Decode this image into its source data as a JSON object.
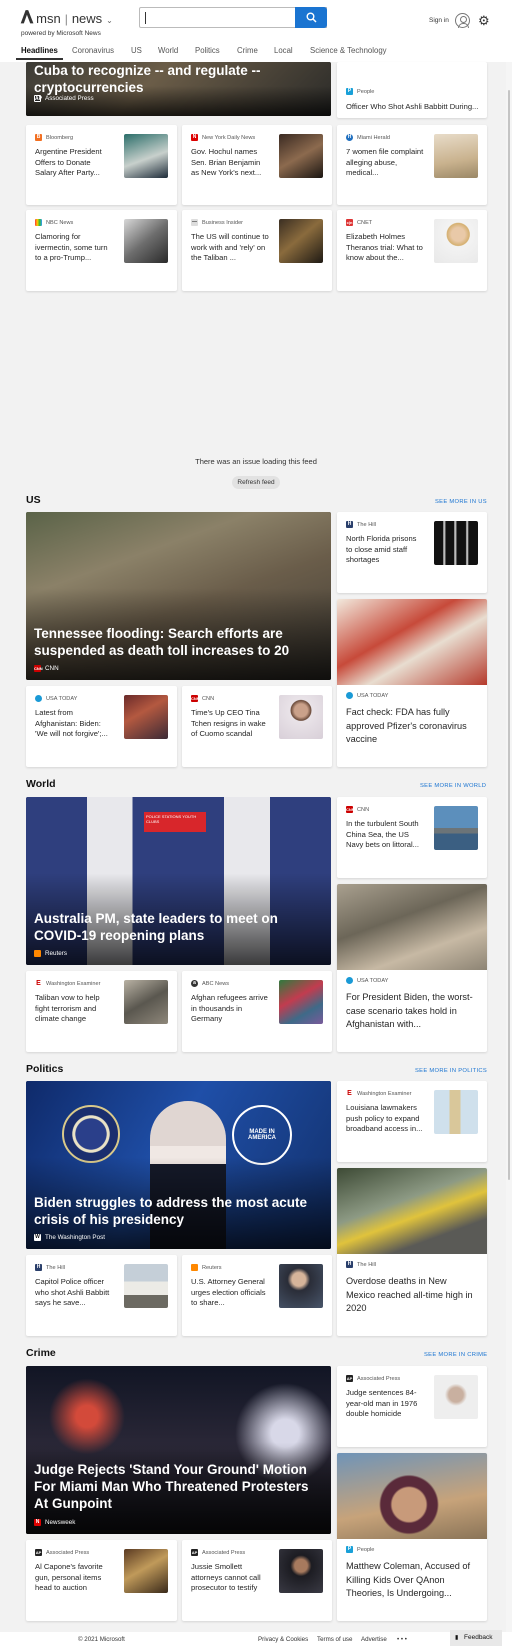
{
  "header": {
    "brand": "msn",
    "section": "news",
    "powered": "powered by Microsoft News",
    "search_value": "",
    "signin": "Sign in",
    "nav": [
      "Headlines",
      "Coronavirus",
      "US",
      "World",
      "Politics",
      "Crime",
      "Local",
      "Science & Technology"
    ]
  },
  "top": {
    "hero_title": "Cuba to recognize -- and regulate -- cryptocurrencies",
    "hero_src": "Associated Press",
    "people_src": "People",
    "people_text": "Officer Who Shot Ashli Babbitt During...",
    "cards": [
      {
        "src": "Bloomberg",
        "text": "Argentine President Offers to Donate Salary After Party..."
      },
      {
        "src": "New York Daily News",
        "text": "Gov. Hochul names Sen. Brian Benjamin as New York's next..."
      },
      {
        "src": "Miami Herald",
        "text": "7 women file complaint alleging abuse, medical..."
      },
      {
        "src": "NBC News",
        "text": "Clamoring for ivermectin, some turn to a pro-Trump..."
      },
      {
        "src": "Business Insider",
        "text": "The US will continue to work with and 'rely' on the Taliban ..."
      },
      {
        "src": "CNET",
        "text": "Elizabeth Holmes Theranos trial: What to know about the..."
      }
    ]
  },
  "feed": {
    "error": "There was an issue loading this feed",
    "refresh": "Refresh feed"
  },
  "us": {
    "title": "US",
    "more": "SEE MORE IN US",
    "hero_title": "Tennessee flooding: Search efforts are suspended as death toll increases to 20",
    "hero_src": "CNN",
    "side": {
      "src": "The Hill",
      "text": "North Florida prisons to close amid staff shortages"
    },
    "tall": {
      "src": "USA TODAY",
      "text": "Fact check: FDA has fully approved Pfizer's coronavirus vaccine"
    },
    "cards": [
      {
        "src": "USA TODAY",
        "text": "Latest from Afghanistan: Biden: 'We will not forgive';..."
      },
      {
        "src": "CNN",
        "text": "Time's Up CEO Tina Tchen resigns in wake of Cuomo scandal"
      }
    ]
  },
  "world": {
    "title": "World",
    "more": "SEE MORE IN WORLD",
    "hero_title": "Australia PM, state leaders to meet on COVID-19 reopening plans",
    "hero_src": "Reuters",
    "side": {
      "src": "CNN",
      "text": "In the turbulent South China Sea, the US Navy bets on littoral..."
    },
    "tall": {
      "src": "USA TODAY",
      "text": "For President Biden, the worst-case scenario takes hold in Afghanistan with..."
    },
    "cards": [
      {
        "src": "Washington Examiner",
        "text": "Taliban vow to help fight terrorism and climate change"
      },
      {
        "src": "ABC News",
        "text": "Afghan refugees arrive in thousands in Germany"
      }
    ],
    "sign": "POLICE STATIONS YOUTH CLUBS"
  },
  "politics": {
    "title": "Politics",
    "more": "SEE MORE IN POLITICS",
    "hero_title": "Biden struggles to address the most acute crisis of his presidency",
    "hero_src": "The Washington Post",
    "badge": "MADE IN AMERICA",
    "side": {
      "src": "Washington Examiner",
      "text": "Louisiana lawmakers push policy to expand broadband access in..."
    },
    "tall": {
      "src": "The Hill",
      "text": "Overdose deaths in New Mexico reached all-time high in 2020"
    },
    "cards": [
      {
        "src": "The Hill",
        "text": "Capitol Police officer who shot Ashli Babbitt says he save..."
      },
      {
        "src": "Reuters",
        "text": "U.S. Attorney General urges election officials to share..."
      }
    ]
  },
  "crime": {
    "title": "Crime",
    "more": "SEE MORE IN CRIME",
    "hero_title": "Judge Rejects 'Stand Your Ground' Motion For Miami Man Who Threatened Protesters At Gunpoint",
    "hero_src": "Newsweek",
    "side": {
      "src": "Associated Press",
      "text": "Judge sentences 84-year-old man in 1976 double homicide"
    },
    "tall": {
      "src": "People",
      "text": "Matthew Coleman, Accused of Killing Kids Over QAnon Theories, Is Undergoing..."
    },
    "cards": [
      {
        "src": "Associated Press",
        "text": "Al Capone's favorite gun, personal items head to auction"
      },
      {
        "src": "Associated Press",
        "text": "Jussie Smollett attorneys cannot call prosecutor to testify"
      }
    ]
  },
  "footer": {
    "copyright": "© 2021 Microsoft",
    "privacy": "Privacy & Cookies",
    "terms": "Terms of use",
    "advertise": "Advertise",
    "more": "• • •",
    "feedback": "Feedback"
  },
  "colors": {
    "accent": "#1a74d1",
    "background": "#f2f2f2"
  }
}
